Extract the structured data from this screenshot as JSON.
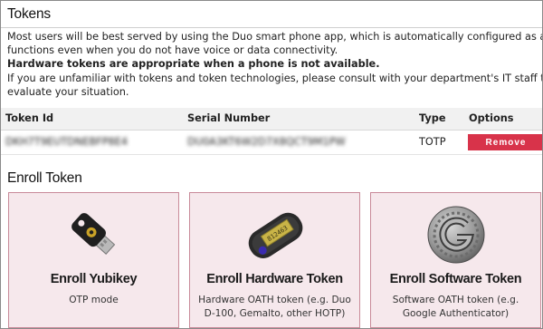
{
  "tokens": {
    "title": "Tokens",
    "intro": {
      "line1": "Most users will be best served by using the Duo smart phone app, which is automatically configured as a token and",
      "line2": "functions even when you do not have voice or data connectivity.",
      "bold_line": "Hardware tokens are appropriate when a phone is not available.",
      "line3": "If you are unfamiliar with tokens and token technologies, please consult with your department's IT staff to help",
      "line4": "evaluate your situation."
    },
    "table": {
      "headers": {
        "token_id": "Token Id",
        "serial": "Serial Number",
        "type": "Type",
        "options": "Options"
      },
      "rows": [
        {
          "token_id": "DKH7T9EUTDNEBFP8E4",
          "serial": "DU0A3KT6W2D7X8QCT9M1PW",
          "type": "TOTP",
          "action": "Remove"
        }
      ]
    }
  },
  "enroll": {
    "title": "Enroll Token",
    "cards": [
      {
        "title": "Enroll Yubikey",
        "desc_line1": "OTP mode",
        "desc_line2": "",
        "icon": "yubikey-icon"
      },
      {
        "title": "Enroll Hardware Token",
        "desc_line1": "Hardware OATH token (e.g. Duo",
        "desc_line2": "D-100, Gemalto, other HOTP)",
        "icon": "hardware-token-icon"
      },
      {
        "title": "Enroll Software Token",
        "desc_line1": "Software OATH token (e.g.",
        "desc_line2": "Google Authenticator)",
        "icon": "google-authenticator-icon"
      }
    ]
  },
  "colors": {
    "remove_button": "#d8334a",
    "card_bg": "#f6e8ec",
    "card_border": "#c98a99"
  }
}
